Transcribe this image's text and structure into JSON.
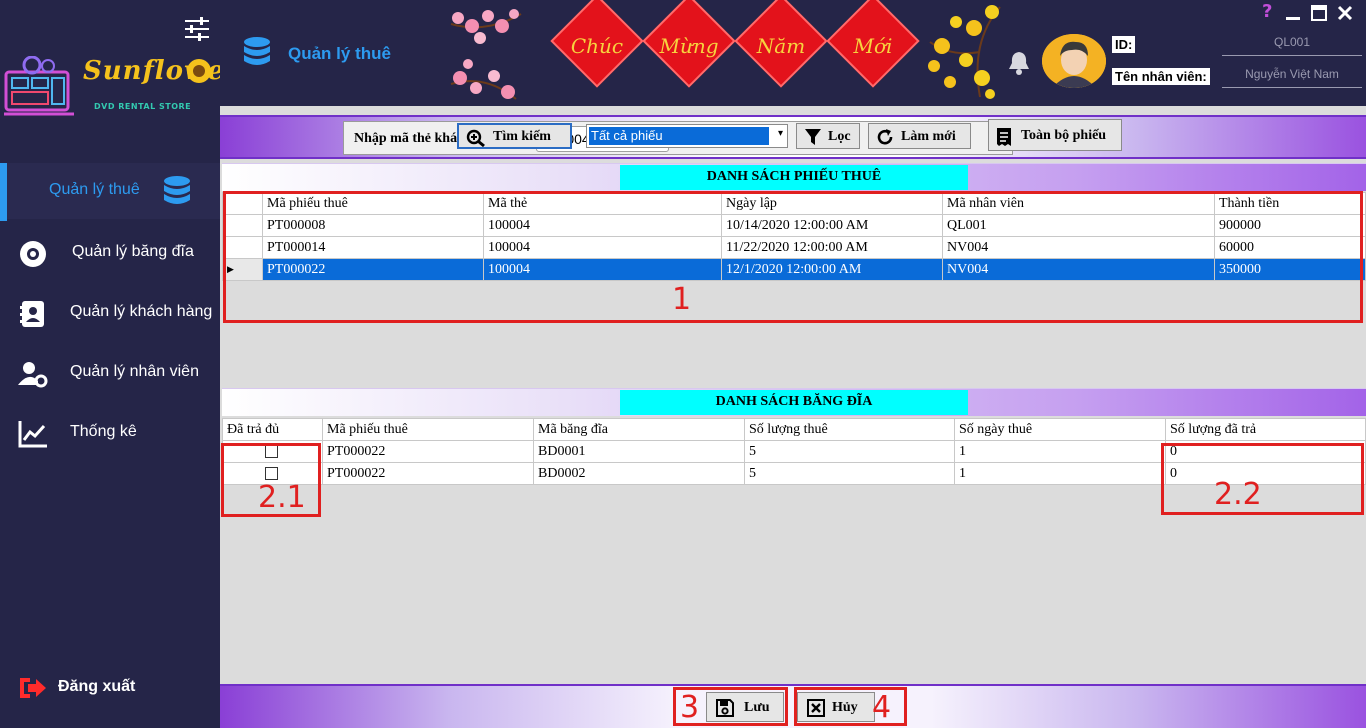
{
  "app": {
    "logo_title": "Sunflower",
    "logo_subtitle": "DVD RENTAL STORE",
    "header_title": "Quản lý thuê"
  },
  "sidebar": {
    "items": [
      {
        "label": "Quản lý thuê",
        "icon": "database-icon",
        "active": true
      },
      {
        "label": "Quản lý băng đĩa",
        "icon": "disc-icon"
      },
      {
        "label": "Quản lý khách hàng",
        "icon": "contact-book-icon"
      },
      {
        "label": "Quản lý nhân viên",
        "icon": "user-gear-icon"
      },
      {
        "label": "Thống kê",
        "icon": "chart-line-icon"
      }
    ],
    "logout_label": "Đăng xuất"
  },
  "banner": {
    "greeting_words": [
      "Chúc",
      "Mừng",
      "Năm",
      "Mới"
    ]
  },
  "user": {
    "id_label": "ID:",
    "id_value": "QL001",
    "name_label": "Tên nhân viên:",
    "name_value": "Nguyễn Việt Nam"
  },
  "window_controls": {
    "help": "?"
  },
  "toolbar": {
    "search_label": "Nhập mã thẻ khách hàng:",
    "search_value": "100004",
    "search_button": "Tìm kiếm",
    "filter_selected": "Tất cả phiếu",
    "filter_button": "Lọc",
    "refresh_button": "Làm mới",
    "all_button": "Toàn bộ phiếu"
  },
  "rentals": {
    "title": "DANH SÁCH PHIẾU THUÊ",
    "columns": [
      "Mã phiếu thuê",
      "Mã thẻ",
      "Ngày lập",
      "Mã nhân viên",
      "Thành tiền"
    ],
    "rows": [
      [
        "PT000008",
        "100004",
        "10/14/2020 12:00:00 AM",
        "QL001",
        "900000"
      ],
      [
        "PT000014",
        "100004",
        "11/22/2020 12:00:00 AM",
        "NV004",
        "60000"
      ],
      [
        "PT000022",
        "100004",
        "12/1/2020 12:00:00 AM",
        "NV004",
        "350000"
      ]
    ],
    "selected_row": 2
  },
  "discs": {
    "title": "DANH SÁCH BĂNG ĐĨA",
    "columns": [
      "Đã trả đủ",
      "Mã phiếu thuê",
      "Mã băng đĩa",
      "Số lượng thuê",
      "Số ngày thuê",
      "Số lượng đã trả"
    ],
    "rows": [
      [
        "",
        "PT000022",
        "BD0001",
        "5",
        "1",
        "0"
      ],
      [
        "",
        "PT000022",
        "BD0002",
        "5",
        "1",
        "0"
      ]
    ]
  },
  "footer": {
    "save_button": "Lưu",
    "cancel_button": "Hủy"
  },
  "annotations": [
    "1",
    "2.1",
    "2.2",
    "3",
    "4"
  ],
  "colors": {
    "sidebar_bg": "#252548",
    "accent": "#2d9bf0",
    "selection": "#0a6bd8",
    "section_title": "#00ffff",
    "annotation": "#e02020"
  }
}
